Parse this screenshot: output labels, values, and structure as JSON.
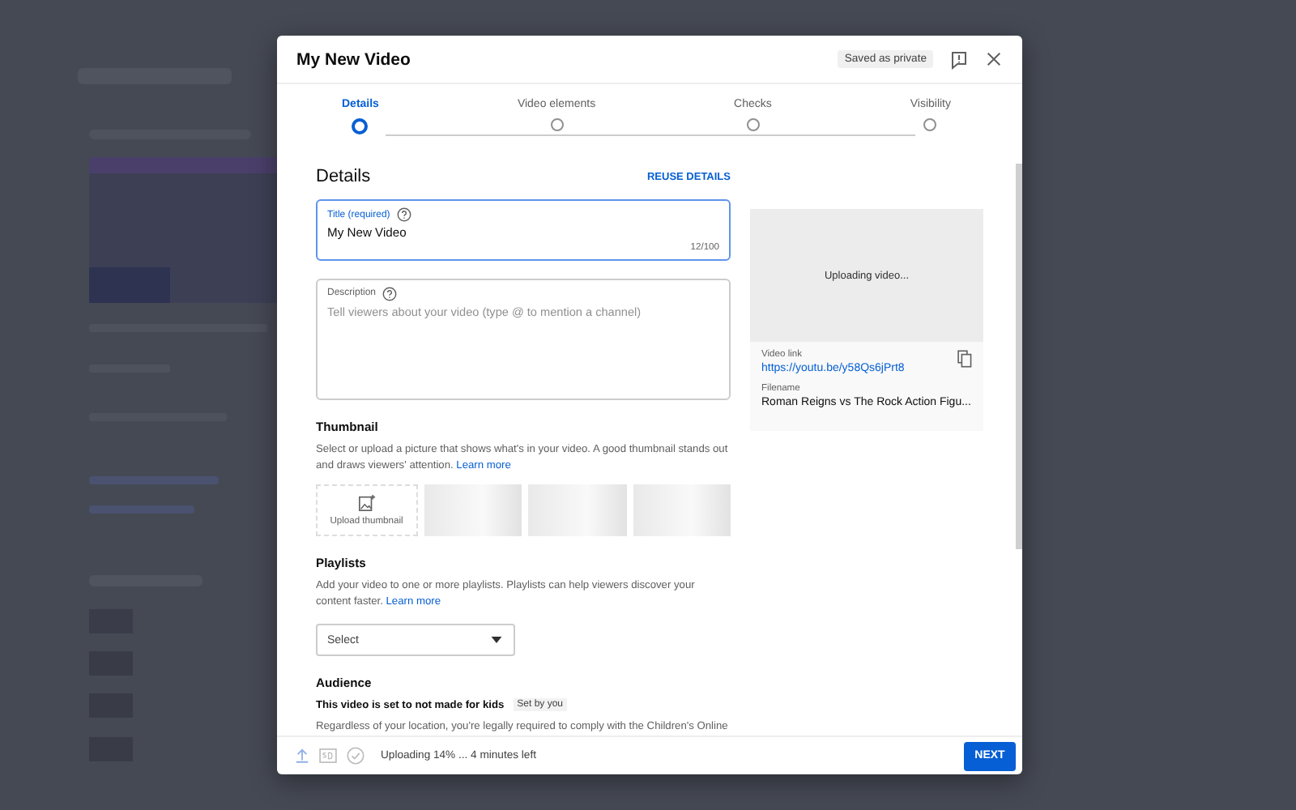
{
  "header": {
    "title": "My New Video",
    "save_status": "Saved as private"
  },
  "steps": [
    {
      "label": "Details",
      "selected": true
    },
    {
      "label": "Video elements",
      "selected": false
    },
    {
      "label": "Checks",
      "selected": false
    },
    {
      "label": "Visibility",
      "selected": false
    }
  ],
  "details": {
    "heading": "Details",
    "reuse": "REUSE DETAILS",
    "title_field": {
      "label": "Title (required)",
      "value": "My New Video",
      "counter": "12/100"
    },
    "description_field": {
      "label": "Description",
      "placeholder": "Tell viewers about your video (type @ to mention a channel)"
    }
  },
  "preview": {
    "status": "Uploading video...",
    "link_label": "Video link",
    "link": "https://youtu.be/y58Qs6jPrt8",
    "filename_label": "Filename",
    "filename": "Roman Reigns vs The Rock Action Figu..."
  },
  "thumbnail": {
    "heading": "Thumbnail",
    "text": "Select or upload a picture that shows what's in your video. A good thumbnail stands out and draws viewers' attention.",
    "link": "Learn more",
    "upload_label": "Upload thumbnail"
  },
  "playlists": {
    "heading": "Playlists",
    "text": "Add your video to one or more playlists. Playlists can help viewers discover your content faster.",
    "link": "Learn more",
    "select": "Select"
  },
  "audience": {
    "heading": "Audience",
    "setting": "This video is set to not made for kids",
    "badge": "Set by you",
    "text": "Regardless of your location, you're legally required to comply with the Children's Online"
  },
  "footer": {
    "status": "Uploading 14% ... 4 minutes left",
    "next": "NEXT"
  }
}
